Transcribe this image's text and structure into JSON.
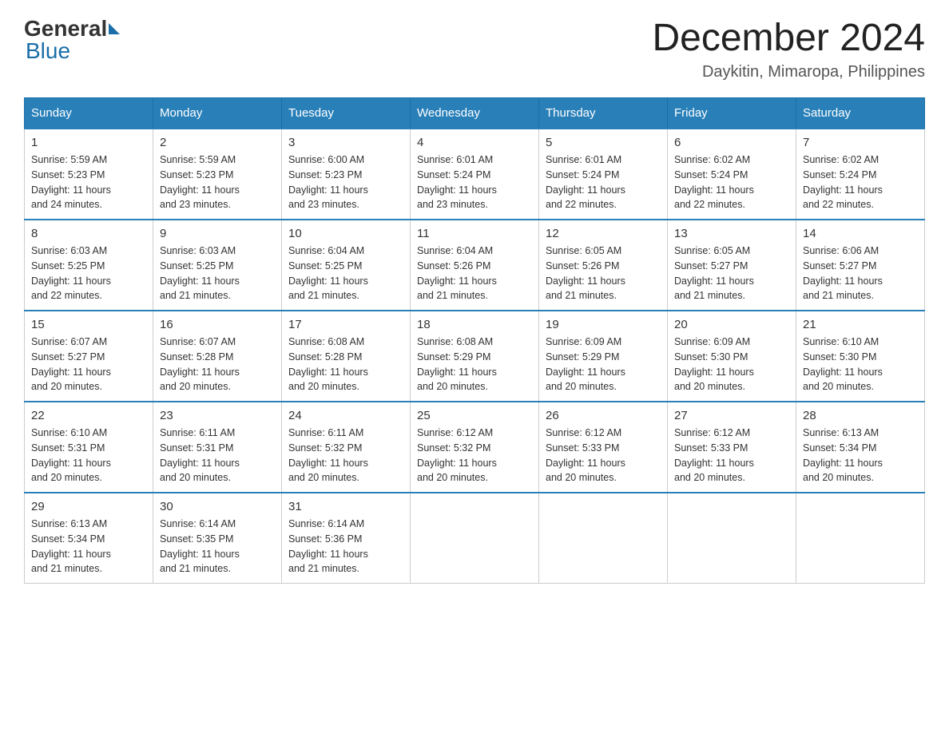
{
  "header": {
    "logo": {
      "general": "General",
      "blue": "Blue"
    },
    "title": "December 2024",
    "location": "Daykitin, Mimaropa, Philippines"
  },
  "days_of_week": [
    "Sunday",
    "Monday",
    "Tuesday",
    "Wednesday",
    "Thursday",
    "Friday",
    "Saturday"
  ],
  "weeks": [
    [
      {
        "day": "1",
        "sunrise": "5:59 AM",
        "sunset": "5:23 PM",
        "daylight": "11 hours and 24 minutes."
      },
      {
        "day": "2",
        "sunrise": "5:59 AM",
        "sunset": "5:23 PM",
        "daylight": "11 hours and 23 minutes."
      },
      {
        "day": "3",
        "sunrise": "6:00 AM",
        "sunset": "5:23 PM",
        "daylight": "11 hours and 23 minutes."
      },
      {
        "day": "4",
        "sunrise": "6:01 AM",
        "sunset": "5:24 PM",
        "daylight": "11 hours and 23 minutes."
      },
      {
        "day": "5",
        "sunrise": "6:01 AM",
        "sunset": "5:24 PM",
        "daylight": "11 hours and 22 minutes."
      },
      {
        "day": "6",
        "sunrise": "6:02 AM",
        "sunset": "5:24 PM",
        "daylight": "11 hours and 22 minutes."
      },
      {
        "day": "7",
        "sunrise": "6:02 AM",
        "sunset": "5:24 PM",
        "daylight": "11 hours and 22 minutes."
      }
    ],
    [
      {
        "day": "8",
        "sunrise": "6:03 AM",
        "sunset": "5:25 PM",
        "daylight": "11 hours and 22 minutes."
      },
      {
        "day": "9",
        "sunrise": "6:03 AM",
        "sunset": "5:25 PM",
        "daylight": "11 hours and 21 minutes."
      },
      {
        "day": "10",
        "sunrise": "6:04 AM",
        "sunset": "5:25 PM",
        "daylight": "11 hours and 21 minutes."
      },
      {
        "day": "11",
        "sunrise": "6:04 AM",
        "sunset": "5:26 PM",
        "daylight": "11 hours and 21 minutes."
      },
      {
        "day": "12",
        "sunrise": "6:05 AM",
        "sunset": "5:26 PM",
        "daylight": "11 hours and 21 minutes."
      },
      {
        "day": "13",
        "sunrise": "6:05 AM",
        "sunset": "5:27 PM",
        "daylight": "11 hours and 21 minutes."
      },
      {
        "day": "14",
        "sunrise": "6:06 AM",
        "sunset": "5:27 PM",
        "daylight": "11 hours and 21 minutes."
      }
    ],
    [
      {
        "day": "15",
        "sunrise": "6:07 AM",
        "sunset": "5:27 PM",
        "daylight": "11 hours and 20 minutes."
      },
      {
        "day": "16",
        "sunrise": "6:07 AM",
        "sunset": "5:28 PM",
        "daylight": "11 hours and 20 minutes."
      },
      {
        "day": "17",
        "sunrise": "6:08 AM",
        "sunset": "5:28 PM",
        "daylight": "11 hours and 20 minutes."
      },
      {
        "day": "18",
        "sunrise": "6:08 AM",
        "sunset": "5:29 PM",
        "daylight": "11 hours and 20 minutes."
      },
      {
        "day": "19",
        "sunrise": "6:09 AM",
        "sunset": "5:29 PM",
        "daylight": "11 hours and 20 minutes."
      },
      {
        "day": "20",
        "sunrise": "6:09 AM",
        "sunset": "5:30 PM",
        "daylight": "11 hours and 20 minutes."
      },
      {
        "day": "21",
        "sunrise": "6:10 AM",
        "sunset": "5:30 PM",
        "daylight": "11 hours and 20 minutes."
      }
    ],
    [
      {
        "day": "22",
        "sunrise": "6:10 AM",
        "sunset": "5:31 PM",
        "daylight": "11 hours and 20 minutes."
      },
      {
        "day": "23",
        "sunrise": "6:11 AM",
        "sunset": "5:31 PM",
        "daylight": "11 hours and 20 minutes."
      },
      {
        "day": "24",
        "sunrise": "6:11 AM",
        "sunset": "5:32 PM",
        "daylight": "11 hours and 20 minutes."
      },
      {
        "day": "25",
        "sunrise": "6:12 AM",
        "sunset": "5:32 PM",
        "daylight": "11 hours and 20 minutes."
      },
      {
        "day": "26",
        "sunrise": "6:12 AM",
        "sunset": "5:33 PM",
        "daylight": "11 hours and 20 minutes."
      },
      {
        "day": "27",
        "sunrise": "6:12 AM",
        "sunset": "5:33 PM",
        "daylight": "11 hours and 20 minutes."
      },
      {
        "day": "28",
        "sunrise": "6:13 AM",
        "sunset": "5:34 PM",
        "daylight": "11 hours and 20 minutes."
      }
    ],
    [
      {
        "day": "29",
        "sunrise": "6:13 AM",
        "sunset": "5:34 PM",
        "daylight": "11 hours and 21 minutes."
      },
      {
        "day": "30",
        "sunrise": "6:14 AM",
        "sunset": "5:35 PM",
        "daylight": "11 hours and 21 minutes."
      },
      {
        "day": "31",
        "sunrise": "6:14 AM",
        "sunset": "5:36 PM",
        "daylight": "11 hours and 21 minutes."
      },
      null,
      null,
      null,
      null
    ]
  ],
  "labels": {
    "sunrise": "Sunrise:",
    "sunset": "Sunset:",
    "daylight": "Daylight:"
  }
}
